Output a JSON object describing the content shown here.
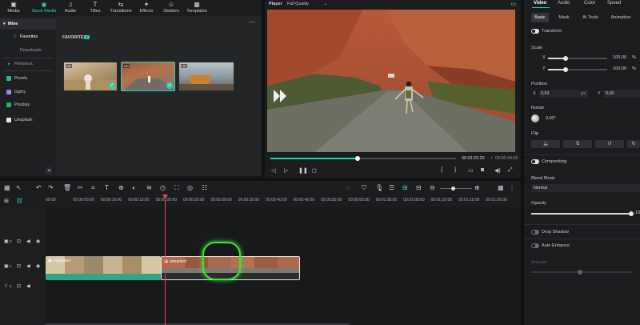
{
  "toolbar": {
    "tabs": [
      {
        "label": "Media",
        "icon": "media-icon"
      },
      {
        "label": "Stock Media",
        "icon": "stock-media-icon"
      },
      {
        "label": "Audio",
        "icon": "audio-icon"
      },
      {
        "label": "Titles",
        "icon": "titles-icon"
      },
      {
        "label": "Transitions",
        "icon": "transitions-icon"
      },
      {
        "label": "Effects",
        "icon": "effects-icon"
      },
      {
        "label": "Stickers",
        "icon": "stickers-icon"
      },
      {
        "label": "Templates",
        "icon": "templates-icon"
      }
    ],
    "active": "Stock Media"
  },
  "sidebar": {
    "mine": "Mine",
    "favorites": "Favorites",
    "downloads": "Downloads",
    "filmstock": "Filmstock",
    "pexels": "Pexels",
    "giphy": "Giphy",
    "pixabay": "Pixabay",
    "unsplash": "Unsplash"
  },
  "media": {
    "section_title": "FAVORITES",
    "section_count": "3",
    "thumb_badge": "HD"
  },
  "player": {
    "title": "Player",
    "quality": "Full Quality",
    "current_time": "00:03:20:20",
    "separator": "/",
    "total_time": "00:00:44:02",
    "progress": 0.47
  },
  "props": {
    "main_tabs": [
      "Video",
      "Audio",
      "Color",
      "Speed"
    ],
    "sub_tabs": [
      "Basic",
      "Mask",
      "AI Tools",
      "Animation"
    ],
    "transform": "Transform",
    "scale": "Scale",
    "scale_x_label": "X",
    "scale_y_label": "Y",
    "scale_x": "100,00",
    "scale_y": "100,00",
    "scale_unit": "%",
    "position": "Position",
    "pos_x_label": "X",
    "pos_x": "0,03",
    "pos_y_label": "Y",
    "pos_y": "0,00",
    "pos_unit": "px",
    "rotate": "Rotate",
    "rotate_value": "0,00°",
    "flip": "Flip",
    "compositing": "Compositing",
    "blend_mode": "Blend Mode",
    "blend_value": "Normal",
    "opacity": "Opacity",
    "opacity_value": "10",
    "drop_shadow": "Drop Shadow",
    "auto_enhance": "Auto Enhance",
    "amount": "Amount"
  },
  "timeline": {
    "ticks": [
      "00:00",
      "00:00:05:00",
      "00:00:10:00",
      "00:00:15:00",
      "00:00:20:00",
      "00:00:25:00",
      "00:00:30:00",
      "00:00:35:00",
      "00:00:40:00",
      "00:00:45:00",
      "00:00:50:00",
      "00:00:55:00",
      "00:01:00:00",
      "00:01:05:00",
      "00:01:10:00",
      "00:01:15:00",
      "00:01:20:00"
    ],
    "clip1_label": "unnamed",
    "clip2_label": "unnamed",
    "track_numbers": [
      "2",
      "1",
      "1"
    ]
  },
  "colors": {
    "accent": "#2fd0b0",
    "playhead": "#e04848",
    "highlight": "#3ee33a"
  }
}
